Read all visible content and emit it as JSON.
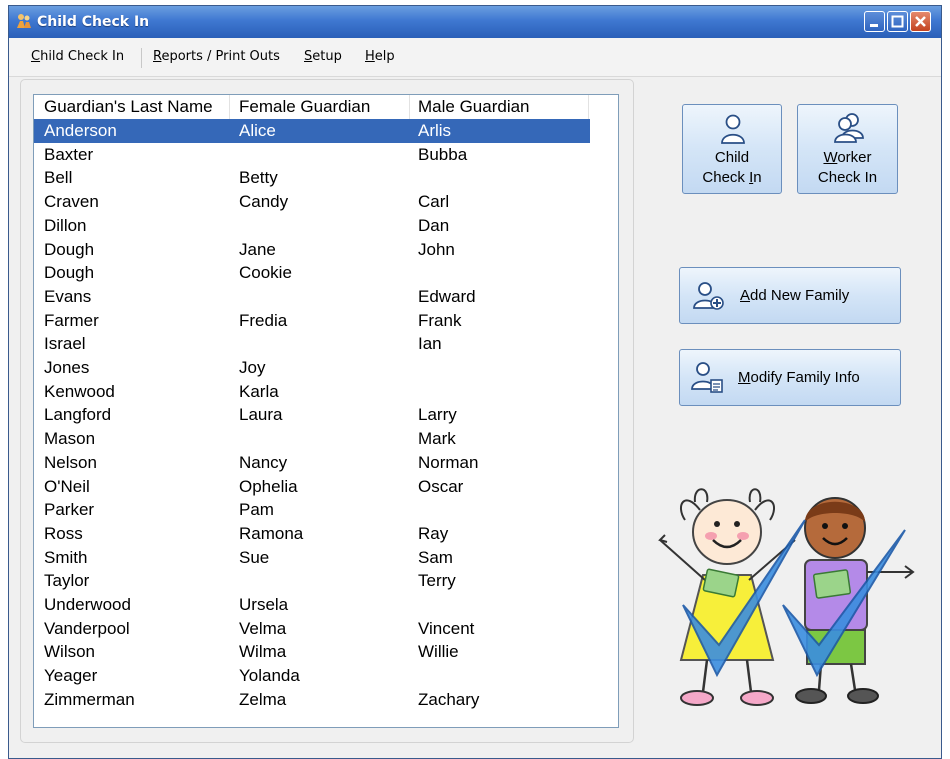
{
  "window": {
    "title": "Child Check In"
  },
  "menu": {
    "items": [
      {
        "label": "Child Check In",
        "accel": "C"
      },
      {
        "label": "Reports / Print Outs",
        "accel": "R"
      },
      {
        "label": "Setup",
        "accel": "S"
      },
      {
        "label": "Help",
        "accel": "H"
      }
    ]
  },
  "families": {
    "columns": [
      "Guardian's Last Name",
      "Female Guardian",
      "Male Guardian"
    ],
    "selected_index": 0,
    "rows": [
      [
        "Anderson",
        "Alice",
        "Arlis"
      ],
      [
        "Baxter",
        "",
        "Bubba"
      ],
      [
        "Bell",
        "Betty",
        ""
      ],
      [
        "Craven",
        "Candy",
        "Carl"
      ],
      [
        "Dillon",
        "",
        "Dan"
      ],
      [
        "Dough",
        "Jane",
        "John"
      ],
      [
        "Dough",
        "Cookie",
        ""
      ],
      [
        "Evans",
        "",
        "Edward"
      ],
      [
        "Farmer",
        "Fredia",
        "Frank"
      ],
      [
        "Israel",
        "",
        "Ian"
      ],
      [
        "Jones",
        "Joy",
        ""
      ],
      [
        "Kenwood",
        "Karla",
        ""
      ],
      [
        "Langford",
        "Laura",
        "Larry"
      ],
      [
        "Mason",
        "",
        "Mark"
      ],
      [
        "Nelson",
        "Nancy",
        "Norman"
      ],
      [
        "O'Neil",
        "Ophelia",
        "Oscar"
      ],
      [
        "Parker",
        "Pam",
        ""
      ],
      [
        "Ross",
        "Ramona",
        "Ray"
      ],
      [
        "Smith",
        "Sue",
        "Sam"
      ],
      [
        "Taylor",
        "",
        "Terry"
      ],
      [
        "Underwood",
        "Ursela",
        ""
      ],
      [
        "Vanderpool",
        "Velma",
        "Vincent"
      ],
      [
        "Wilson",
        "Wilma",
        "Willie"
      ],
      [
        "Yeager",
        "Yolanda",
        ""
      ],
      [
        "Zimmerman",
        "Zelma",
        "Zachary"
      ]
    ]
  },
  "buttons": {
    "child_check_in": {
      "line1": "Child",
      "line2_pre": "Check ",
      "line2_accel": "I",
      "line2_post": "n",
      "icon": "person-icon"
    },
    "worker_check_in": {
      "line1_accel": "W",
      "line1_post": "orker",
      "line2": "Check In",
      "icon": "people-icon"
    },
    "add_new_family": {
      "accel": "A",
      "rest": "dd New Family",
      "icon": "add-person-icon"
    },
    "modify_family_info": {
      "accel": "M",
      "rest": "odify Family Info",
      "icon": "edit-person-icon"
    }
  },
  "colors": {
    "title_bar": "#3f78d1",
    "selection": "#3568b8",
    "button_face": "#d4e5f7",
    "button_border": "#6b8fbd"
  }
}
